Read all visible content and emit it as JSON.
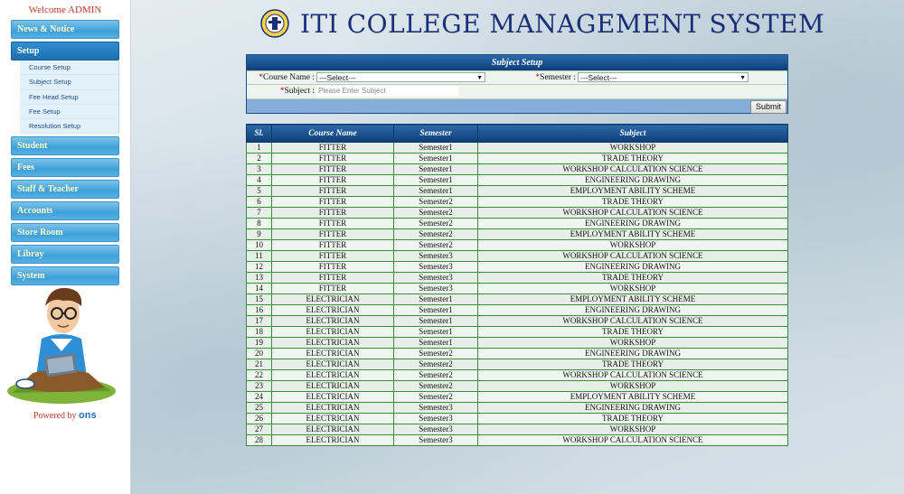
{
  "app": {
    "title": "ITI COLLEGE MANAGEMENT SYSTEM",
    "welcome": "Welcome ADMIN"
  },
  "sidebar": {
    "menu": [
      {
        "label": "News & Notice"
      },
      {
        "label": "Setup",
        "active": true
      },
      {
        "label": "Student"
      },
      {
        "label": "Fees"
      },
      {
        "label": "Staff & Teacher"
      },
      {
        "label": "Accounts"
      },
      {
        "label": "Store Room"
      },
      {
        "label": "Libray"
      },
      {
        "label": "System"
      }
    ],
    "setup_items": [
      "Course Setup",
      "Subject Setup",
      "Fee Head Setup",
      "Fee Setup",
      "Resolution Setup"
    ],
    "powered_by": "Powered by",
    "brand": "ons"
  },
  "form": {
    "title": "Subject Setup",
    "course_label": "Course Name :",
    "course_value": "---Select---",
    "semester_label": "Semester :",
    "semester_value": "---Select---",
    "subject_label": "Subject :",
    "subject_placeholder": "Please Enter Subject",
    "submit_label": "Submit"
  },
  "table": {
    "headers": [
      "Sl.",
      "Course Name",
      "Semester",
      "Subject"
    ],
    "rows": [
      [
        "1",
        "FITTER",
        "Semester1",
        "WORKSHOP"
      ],
      [
        "2",
        "FITTER",
        "Semester1",
        "TRADE THEORY"
      ],
      [
        "3",
        "FITTER",
        "Semester1",
        "WORKSHOP CALCULATION SCIENCE"
      ],
      [
        "4",
        "FITTER",
        "Semester1",
        "ENGINEERING DRAWING"
      ],
      [
        "5",
        "FITTER",
        "Semester1",
        "EMPLOYMENT ABILITY SCHEME"
      ],
      [
        "6",
        "FITTER",
        "Semester2",
        "TRADE THEORY"
      ],
      [
        "7",
        "FITTER",
        "Semester2",
        "WORKSHOP CALCULATION SCIENCE"
      ],
      [
        "8",
        "FITTER",
        "Semester2",
        "ENGINEERING DRAWING"
      ],
      [
        "9",
        "FITTER",
        "Semester2",
        "EMPLOYMENT ABILITY SCHEME"
      ],
      [
        "10",
        "FITTER",
        "Semester2",
        "WORKSHOP"
      ],
      [
        "11",
        "FITTER",
        "Semester3",
        "WORKSHOP CALCULATION SCIENCE"
      ],
      [
        "12",
        "FITTER",
        "Semester3",
        "ENGINEERING DRAWING"
      ],
      [
        "13",
        "FITTER",
        "Semester3",
        "TRADE THEORY"
      ],
      [
        "14",
        "FITTER",
        "Semester3",
        "WORKSHOP"
      ],
      [
        "15",
        "ELECTRICIAN",
        "Semester1",
        "EMPLOYMENT ABILITY SCHEME"
      ],
      [
        "16",
        "ELECTRICIAN",
        "Semester1",
        "ENGINEERING DRAWING"
      ],
      [
        "17",
        "ELECTRICIAN",
        "Semester1",
        "WORKSHOP CALCULATION SCIENCE"
      ],
      [
        "18",
        "ELECTRICIAN",
        "Semester1",
        "TRADE THEORY"
      ],
      [
        "19",
        "ELECTRICIAN",
        "Semester1",
        "WORKSHOP"
      ],
      [
        "20",
        "ELECTRICIAN",
        "Semester2",
        "ENGINEERING DRAWING"
      ],
      [
        "21",
        "ELECTRICIAN",
        "Semester2",
        "TRADE THEORY"
      ],
      [
        "22",
        "ELECTRICIAN",
        "Semester2",
        "WORKSHOP CALCULATION SCIENCE"
      ],
      [
        "23",
        "ELECTRICIAN",
        "Semester2",
        "WORKSHOP"
      ],
      [
        "24",
        "ELECTRICIAN",
        "Semester2",
        "EMPLOYMENT ABILITY SCHEME"
      ],
      [
        "25",
        "ELECTRICIAN",
        "Semester3",
        "ENGINEERING DRAWING"
      ],
      [
        "26",
        "ELECTRICIAN",
        "Semester3",
        "TRADE THEORY"
      ],
      [
        "27",
        "ELECTRICIAN",
        "Semester3",
        "WORKSHOP"
      ],
      [
        "28",
        "ELECTRICIAN",
        "Semester3",
        "WORKSHOP CALCULATION SCIENCE"
      ]
    ]
  },
  "colors": {
    "title": "#1b2f77",
    "header_bar": "#0e3e78",
    "menu": "#3d9fd8",
    "required": "#d0021b"
  }
}
